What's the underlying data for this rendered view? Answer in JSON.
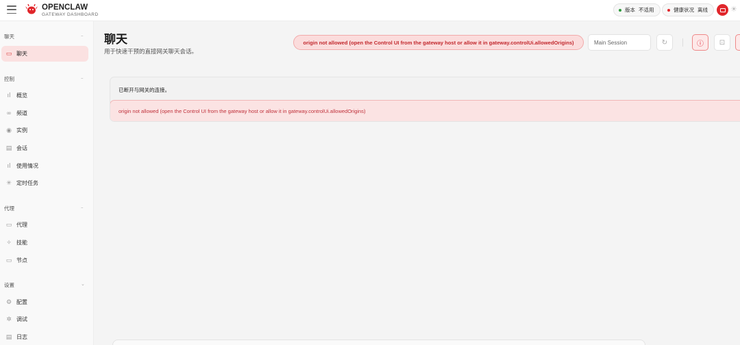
{
  "app": {
    "brand_name": "OPENCLAW",
    "brand_subtitle": "GATEWAY DASHBOARD",
    "brand_color": "#e0262b"
  },
  "header": {
    "version_label": "版本",
    "version_value": "不适用",
    "health_label": "健康状况",
    "health_value": "离线",
    "version_dot_color": "#2e9a3c",
    "health_dot_color": "#e0262b"
  },
  "sidebar": {
    "sections": [
      {
        "label": "聊天",
        "items": [
          {
            "label": "聊天",
            "icon": "chat-bubble-icon",
            "active": true
          }
        ]
      },
      {
        "label": "控制",
        "items": [
          {
            "label": "概览",
            "icon": "bar-chart-icon"
          },
          {
            "label": "频道",
            "icon": "link-icon"
          },
          {
            "label": "实例",
            "icon": "broadcast-icon"
          },
          {
            "label": "会话",
            "icon": "document-icon"
          },
          {
            "label": "使用情况",
            "icon": "bar-chart-icon"
          },
          {
            "label": "定时任务",
            "icon": "loader-icon"
          }
        ]
      },
      {
        "label": "代理",
        "items": [
          {
            "label": "代理",
            "icon": "folder-icon"
          },
          {
            "label": "技能",
            "icon": "sparkle-icon"
          },
          {
            "label": "节点",
            "icon": "monitor-icon"
          }
        ]
      },
      {
        "label": "设置",
        "items": [
          {
            "label": "配置",
            "icon": "gear-icon"
          },
          {
            "label": "调试",
            "icon": "bug-icon"
          },
          {
            "label": "日志",
            "icon": "log-icon"
          }
        ]
      }
    ]
  },
  "main": {
    "title": "聊天",
    "subtitle": "用于快速干预的直接网关聊天会话。",
    "error_pill": "origin not allowed (open the Control UI from the gateway host or allow it in gateway.controlUi.allowedOrigins)",
    "session_select": "Main Session",
    "notice_text": "已断开与网关的连接。",
    "notice_error": "origin not allowed (open the Control UI from the gateway host or allow it in gateway.controlUi.allowedOrigins)"
  }
}
